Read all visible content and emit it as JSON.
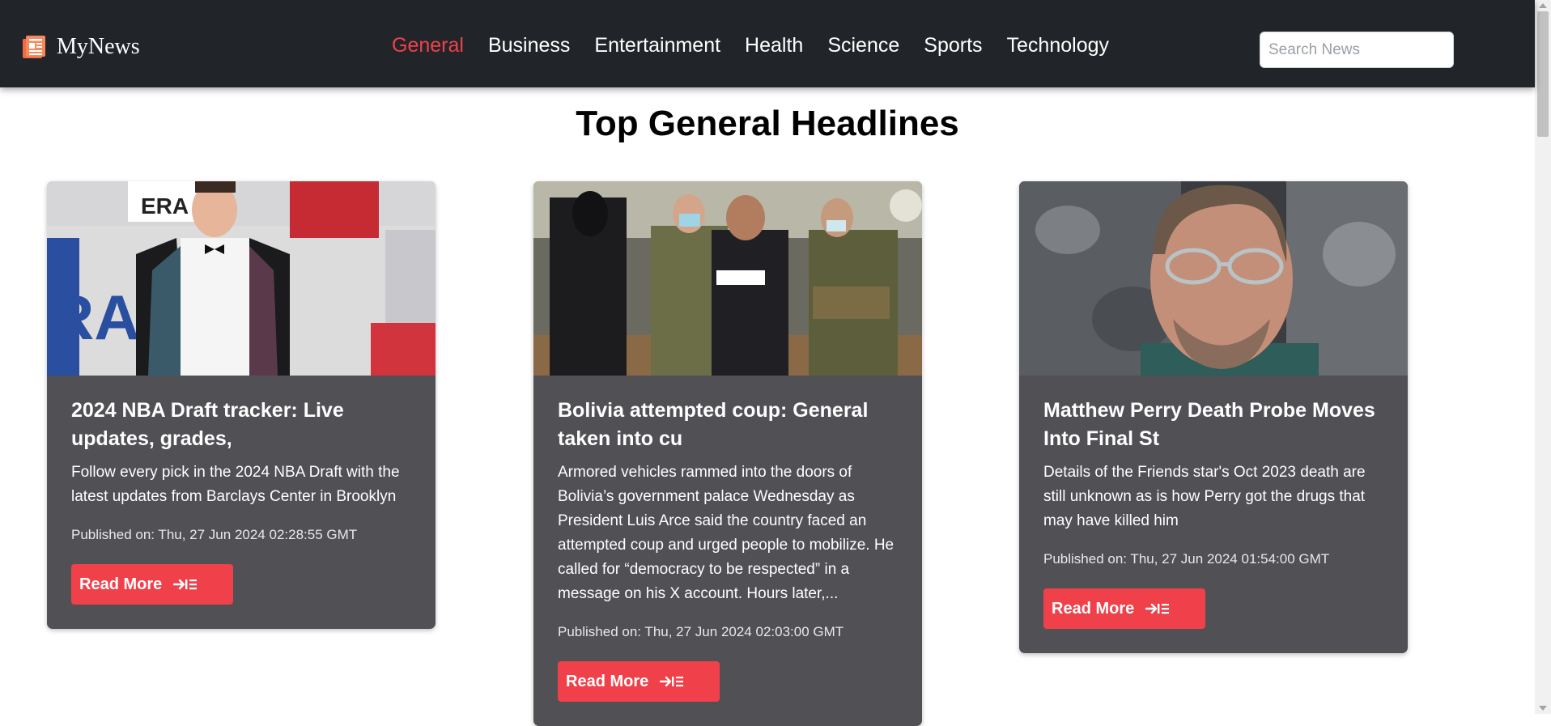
{
  "app": {
    "brand": "MyNews",
    "brand_icon": "newspaper-icon",
    "accent_color": "#f0414a",
    "navbar_color": "#212529"
  },
  "nav": {
    "items": [
      {
        "label": "General",
        "active": true
      },
      {
        "label": "Business",
        "active": false
      },
      {
        "label": "Entertainment",
        "active": false
      },
      {
        "label": "Health",
        "active": false
      },
      {
        "label": "Science",
        "active": false
      },
      {
        "label": "Sports",
        "active": false
      },
      {
        "label": "Technology",
        "active": false
      }
    ]
  },
  "search": {
    "placeholder": "Search News",
    "value": ""
  },
  "page": {
    "title": "Top General Headlines"
  },
  "articles": [
    {
      "title": "2024 NBA Draft tracker: Live updates, grades,",
      "description": "Follow every pick in the 2024 NBA Draft with the latest updates from Barclays Center in Brooklyn",
      "published": "Published on: Thu, 27 Jun 2024 02:28:55 GMT",
      "button": "Read More",
      "button_icon": "arrow-to-list-icon",
      "image": "nba-draft-photo"
    },
    {
      "title": "Bolivia attempted coup: General taken into cu",
      "description": "Armored vehicles rammed into the doors of Bolivia’s government palace Wednesday as President Luis Arce said the country faced an attempted coup and urged people to mobilize. He called for “democracy to be respected” in a message on his X account. Hours later,...",
      "published": "Published on: Thu, 27 Jun 2024 02:03:00 GMT",
      "button": "Read More",
      "button_icon": "arrow-to-list-icon",
      "image": "bolivia-arrest-photo"
    },
    {
      "title": "Matthew Perry Death Probe Moves Into Final St",
      "description": "Details of the Friends star's Oct 2023 death are still unknown as is how Perry got the drugs that may have killed him",
      "published": "Published on: Thu, 27 Jun 2024 01:54:00 GMT",
      "button": "Read More",
      "button_icon": "arrow-to-list-icon",
      "image": "matthew-perry-photo"
    }
  ]
}
